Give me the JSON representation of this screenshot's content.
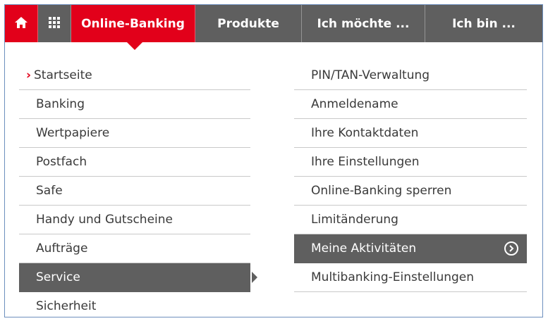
{
  "nav": {
    "home_icon": "home-icon",
    "grid_icon": "grid-icon",
    "tabs": [
      {
        "label": "Online-Banking"
      },
      {
        "label": "Produkte"
      },
      {
        "label": "Ich möchte ..."
      },
      {
        "label": "Ich bin ..."
      }
    ]
  },
  "left_menu": {
    "items": [
      {
        "label": "Startseite"
      },
      {
        "label": "Banking"
      },
      {
        "label": "Wertpapiere"
      },
      {
        "label": "Postfach"
      },
      {
        "label": "Safe"
      },
      {
        "label": "Handy und Gutscheine"
      },
      {
        "label": "Aufträge"
      },
      {
        "label": "Service"
      },
      {
        "label": "Sicherheit"
      }
    ]
  },
  "right_menu": {
    "items": [
      {
        "label": "PIN/TAN-Verwaltung"
      },
      {
        "label": "Anmeldename"
      },
      {
        "label": "Ihre Kontaktdaten"
      },
      {
        "label": "Ihre Einstellungen"
      },
      {
        "label": "Online-Banking sperren"
      },
      {
        "label": "Limitänderung"
      },
      {
        "label": "Meine Aktivitäten"
      },
      {
        "label": "Multibanking-Einstellungen"
      }
    ]
  },
  "colors": {
    "brand_red": "#e2001a",
    "nav_gray": "#5f5f5f"
  }
}
